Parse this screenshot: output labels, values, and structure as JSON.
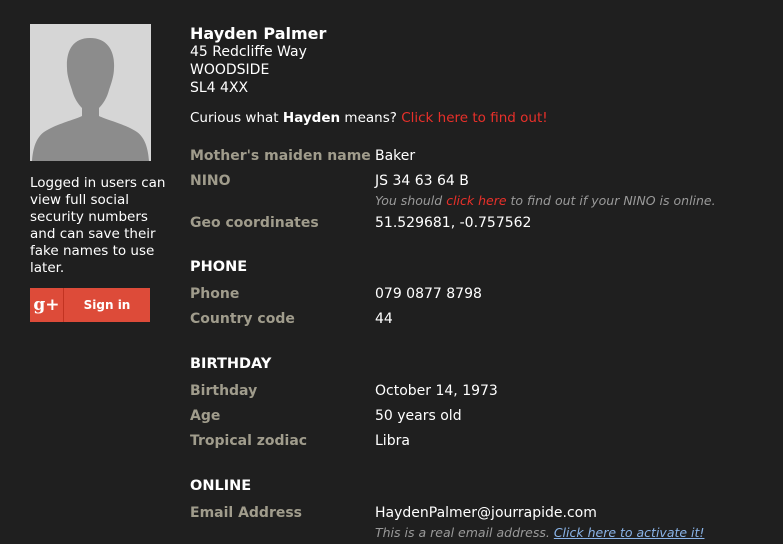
{
  "profile": {
    "name": "Hayden Palmer",
    "address_line1": "45 Redcliffe Way",
    "address_line2": "WOODSIDE",
    "address_line3": "SL4 4XX",
    "curious_prefix": "Curious what ",
    "curious_name": "Hayden",
    "curious_suffix": " means? ",
    "curious_link": "Click here to find out!"
  },
  "sidebar": {
    "avatar_icon": "silhouette-avatar",
    "login_note": "Logged in users can view full social security numbers and can save their fake names to use later.",
    "signin_icon": "g+",
    "signin_label": "Sign in"
  },
  "details": {
    "mmn_label": "Mother's maiden name",
    "mmn_value": "Baker",
    "nino_label": "NINO",
    "nino_value": "JS 34 63 64 B",
    "nino_note_prefix": "You should ",
    "nino_note_link": "click here",
    "nino_note_suffix": " to find out if your NINO is online.",
    "geo_label": "Geo coordinates",
    "geo_value": "51.529681, -0.757562"
  },
  "phone_section": {
    "title": "PHONE",
    "phone_label": "Phone",
    "phone_value": "079 0877 8798",
    "country_label": "Country code",
    "country_value": "44"
  },
  "birthday_section": {
    "title": "BIRTHDAY",
    "birthday_label": "Birthday",
    "birthday_value": "October 14, 1973",
    "age_label": "Age",
    "age_value": "50 years old",
    "zodiac_label": "Tropical zodiac",
    "zodiac_value": "Libra"
  },
  "online_section": {
    "title": "ONLINE",
    "email_label": "Email Address",
    "email_value": "HaydenPalmer@jourrapide.com",
    "email_note_prefix": "This is a real email address. ",
    "email_note_link": "Click here to activate it!"
  },
  "colors": {
    "background": "#1f1f1f",
    "label": "#a09c8c",
    "accent_red": "#e8302a",
    "google_red": "#dd4b39",
    "link_blue": "#8ab4e8"
  }
}
